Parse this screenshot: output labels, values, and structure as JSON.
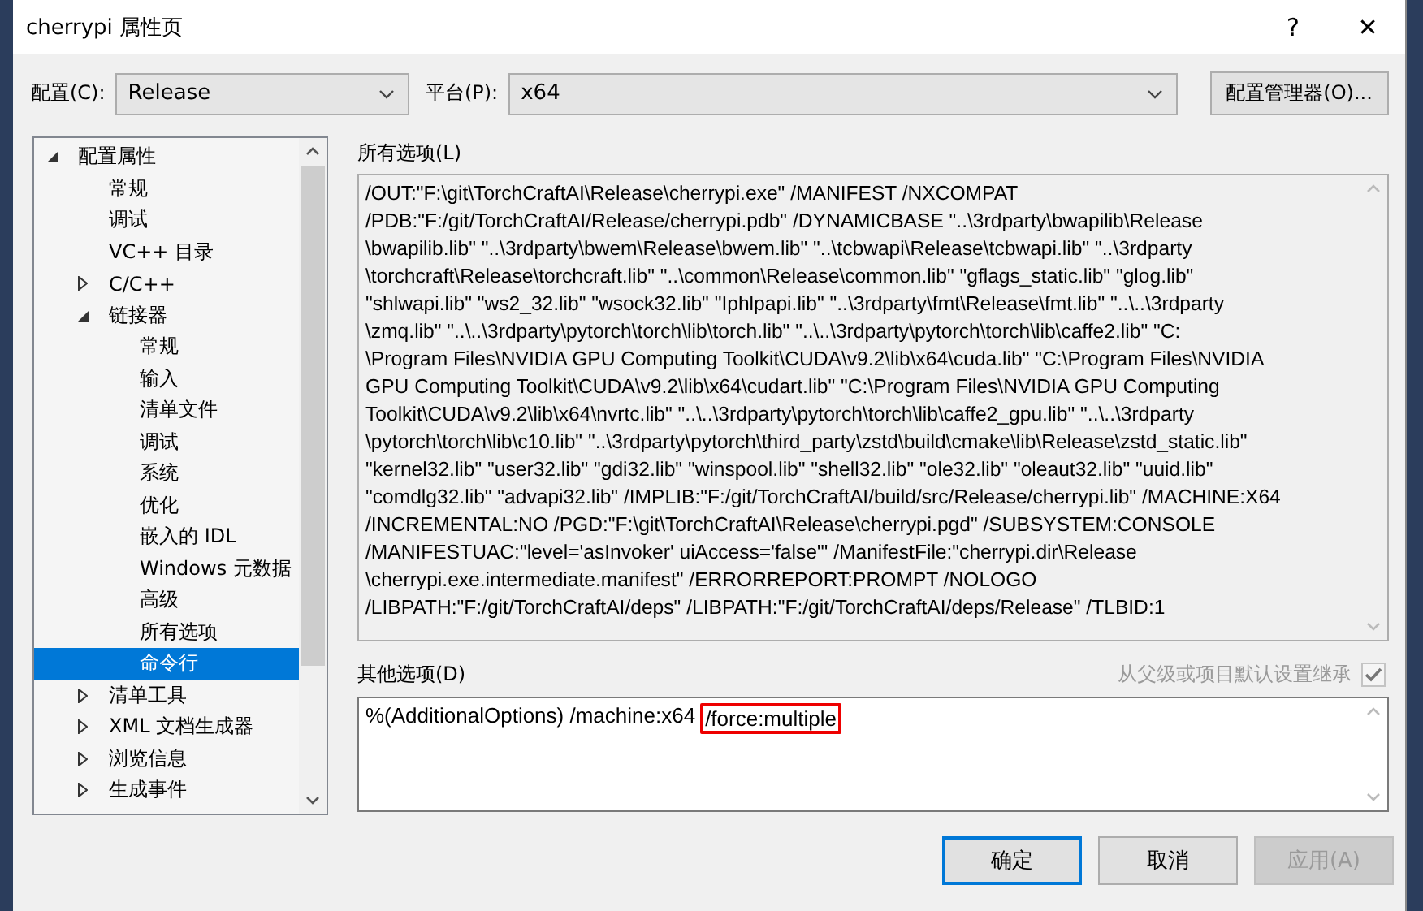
{
  "window": {
    "title": "cherrypi 属性页",
    "help": "?",
    "close": "✕"
  },
  "config": {
    "label": "配置(C):",
    "value": "Release"
  },
  "platform": {
    "label": "平台(P):",
    "value": "x64"
  },
  "config_manager_button": "配置管理器(O)...",
  "tree": [
    {
      "label": "配置属性",
      "expanded": true,
      "selected": false,
      "children": [
        {
          "label": "常规",
          "selected": false
        },
        {
          "label": "调试",
          "selected": false
        },
        {
          "label": "VC++ 目录",
          "selected": false
        },
        {
          "label": "C/C++",
          "expanded": false,
          "selected": false
        },
        {
          "label": "链接器",
          "expanded": true,
          "selected": false,
          "children": [
            {
              "label": "常规",
              "selected": false
            },
            {
              "label": "输入",
              "selected": false
            },
            {
              "label": "清单文件",
              "selected": false
            },
            {
              "label": "调试",
              "selected": false
            },
            {
              "label": "系统",
              "selected": false
            },
            {
              "label": "优化",
              "selected": false
            },
            {
              "label": "嵌入的 IDL",
              "selected": false
            },
            {
              "label": "Windows 元数据",
              "selected": false
            },
            {
              "label": "高级",
              "selected": false
            },
            {
              "label": "所有选项",
              "selected": false
            },
            {
              "label": "命令行",
              "selected": true
            }
          ]
        },
        {
          "label": "清单工具",
          "expanded": false,
          "selected": false
        },
        {
          "label": "XML 文档生成器",
          "expanded": false,
          "selected": false
        },
        {
          "label": "浏览信息",
          "expanded": false,
          "selected": false
        },
        {
          "label": "生成事件",
          "expanded": false,
          "selected": false
        }
      ]
    }
  ],
  "all_options": {
    "label": "所有选项(L)",
    "lines": [
      "/OUT:\"F:\\git\\TorchCraftAI\\Release\\cherrypi.exe\" /MANIFEST /NXCOMPAT",
      "/PDB:\"F:/git/TorchCraftAI/Release/cherrypi.pdb\" /DYNAMICBASE \"..\\3rdparty\\bwapilib\\Release",
      "\\bwapilib.lib\" \"..\\3rdparty\\bwem\\Release\\bwem.lib\" \"..\\tcbwapi\\Release\\tcbwapi.lib\" \"..\\3rdparty",
      "\\torchcraft\\Release\\torchcraft.lib\" \"..\\common\\Release\\common.lib\" \"gflags_static.lib\" \"glog.lib\"",
      "\"shlwapi.lib\" \"ws2_32.lib\" \"wsock32.lib\" \"Iphlpapi.lib\" \"..\\3rdparty\\fmt\\Release\\fmt.lib\" \"..\\..\\3rdparty",
      "\\zmq.lib\" \"..\\..\\3rdparty\\pytorch\\torch\\lib\\torch.lib\" \"..\\..\\3rdparty\\pytorch\\torch\\lib\\caffe2.lib\" \"C:",
      "\\Program Files\\NVIDIA GPU Computing Toolkit\\CUDA\\v9.2\\lib\\x64\\cuda.lib\" \"C:\\Program Files\\NVIDIA",
      "GPU Computing Toolkit\\CUDA\\v9.2\\lib\\x64\\cudart.lib\" \"C:\\Program Files\\NVIDIA GPU Computing",
      "Toolkit\\CUDA\\v9.2\\lib\\x64\\nvrtc.lib\" \"..\\..\\3rdparty\\pytorch\\torch\\lib\\caffe2_gpu.lib\" \"..\\..\\3rdparty",
      "\\pytorch\\torch\\lib\\c10.lib\" \"..\\3rdparty\\pytorch\\third_party\\zstd\\build\\cmake\\lib\\Release\\zstd_static.lib\"",
      "\"kernel32.lib\" \"user32.lib\" \"gdi32.lib\" \"winspool.lib\" \"shell32.lib\" \"ole32.lib\" \"oleaut32.lib\" \"uuid.lib\"",
      "\"comdlg32.lib\" \"advapi32.lib\" /IMPLIB:\"F:/git/TorchCraftAI/build/src/Release/cherrypi.lib\" /MACHINE:X64",
      "/INCREMENTAL:NO /PGD:\"F:\\git\\TorchCraftAI\\Release\\cherrypi.pgd\" /SUBSYSTEM:CONSOLE",
      "/MANIFESTUAC:\"level='asInvoker' uiAccess='false'\" /ManifestFile:\"cherrypi.dir\\Release",
      "\\cherrypi.exe.intermediate.manifest\" /ERRORREPORT:PROMPT /NOLOGO",
      "/LIBPATH:\"F:/git/TorchCraftAI/deps\" /LIBPATH:\"F:/git/TorchCraftAI/deps/Release\" /TLBID:1"
    ]
  },
  "other_options": {
    "label": "其他选项(D)",
    "inherit": {
      "label": "从父级或项目默认设置继承",
      "checked": true,
      "disabled": true
    },
    "value_parts": [
      {
        "text": "%(AdditionalOptions) /machine:x64",
        "highlighted": false
      },
      {
        "text": "/force:multiple",
        "highlighted": true
      }
    ]
  },
  "buttons": [
    {
      "label": "确定",
      "default": true,
      "disabled": false
    },
    {
      "label": "取消",
      "default": false,
      "disabled": false
    },
    {
      "label": "应用(A)",
      "default": false,
      "disabled": true
    }
  ]
}
